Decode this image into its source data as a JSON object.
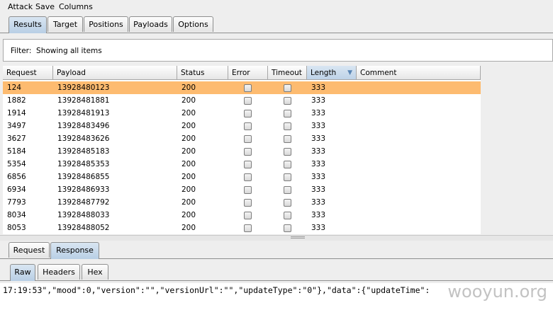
{
  "menu": [
    "Attack",
    "Save",
    "Columns"
  ],
  "main_tabs": [
    "Results",
    "Target",
    "Positions",
    "Payloads",
    "Options"
  ],
  "filter": {
    "label": "Filter:",
    "text": "Showing all items"
  },
  "table": {
    "headers": [
      "Request",
      "Payload",
      "Status",
      "Error",
      "Timeout",
      "Length",
      "Comment"
    ],
    "sorted_column": "Length",
    "rows": [
      [
        "124",
        "13928480123",
        "200",
        "333"
      ],
      [
        "1882",
        "13928481881",
        "200",
        "333"
      ],
      [
        "1914",
        "13928481913",
        "200",
        "333"
      ],
      [
        "3497",
        "13928483496",
        "200",
        "333"
      ],
      [
        "3627",
        "13928483626",
        "200",
        "333"
      ],
      [
        "5184",
        "13928485183",
        "200",
        "333"
      ],
      [
        "5354",
        "13928485353",
        "200",
        "333"
      ],
      [
        "6856",
        "13928486855",
        "200",
        "333"
      ],
      [
        "6934",
        "13928486933",
        "200",
        "333"
      ],
      [
        "7793",
        "13928487792",
        "200",
        "333"
      ],
      [
        "8034",
        "13928488033",
        "200",
        "333"
      ],
      [
        "8053",
        "13928488052",
        "200",
        "333"
      ]
    ],
    "selected_row": 0
  },
  "detail_tabs": [
    "Request",
    "Response"
  ],
  "view_tabs": [
    "Raw",
    "Headers",
    "Hex"
  ],
  "response_text": "17:19:53\",\"mood\":0,\"version\":\"\",\"versionUrl\":\"\",\"updateType\":\"0\"},\"data\":{\"updateTime\":",
  "watermark": "wooyun.org",
  "colors": {
    "selected_row": "#fdbb70",
    "active_tab": "#c5d8ec"
  }
}
